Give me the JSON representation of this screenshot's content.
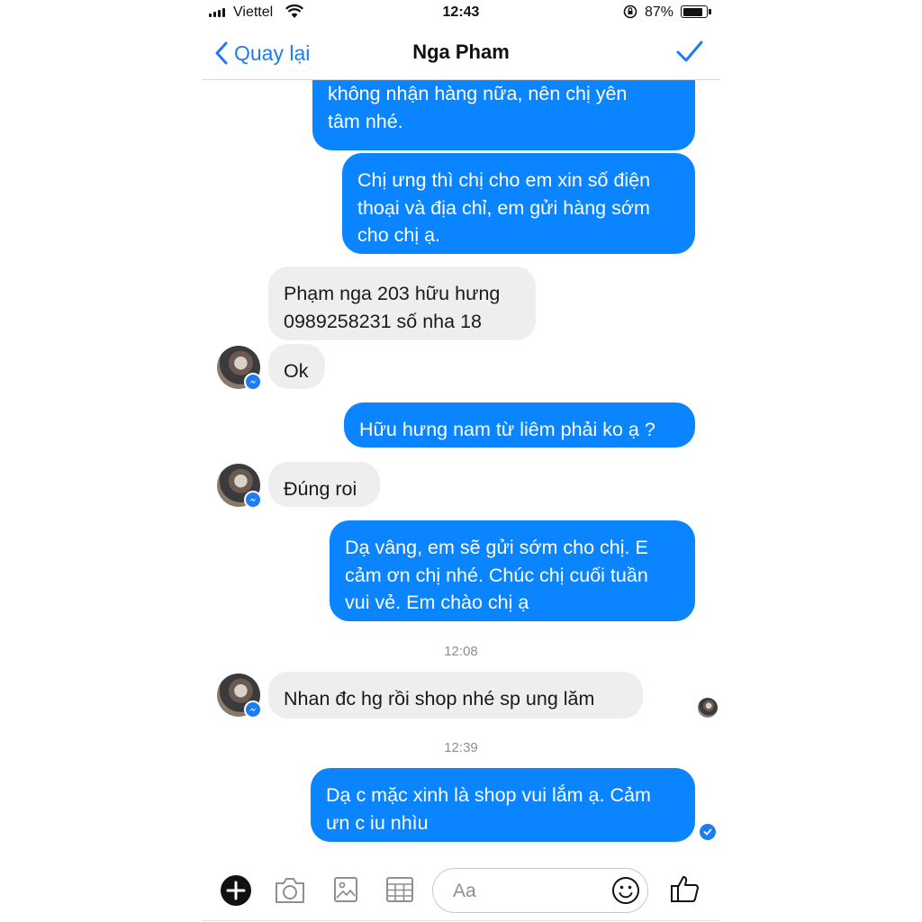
{
  "status_bar": {
    "carrier": "Viettel",
    "time": "12:43",
    "battery": "87%",
    "battery_level": 0.87
  },
  "header": {
    "back_label": "Quay lại",
    "title": "Nga Pham"
  },
  "messages": [
    {
      "dir": "out",
      "text": "không nhận hàng nữa, nên chị yên\ntâm nhé."
    },
    {
      "dir": "out",
      "text": "Chị ưng thì chị cho em xin số điện\nthoại và địa chỉ, em gửi hàng sớm\ncho chị ạ."
    },
    {
      "dir": "in",
      "text": "Phạm nga 203 hữu hưng\n0989258231 số nha 18"
    },
    {
      "dir": "in",
      "text": "Ok"
    },
    {
      "dir": "out",
      "text": "Hữu hưng nam từ liêm phải ko ạ ?"
    },
    {
      "dir": "in",
      "text": "Đúng roi"
    },
    {
      "dir": "out",
      "text": "Dạ vâng, em sẽ gửi sớm cho chị. E\ncảm ơn chị nhé. Chúc chị cuối tuần\nvui vẻ. Em chào chị ạ"
    },
    {
      "dir": "in",
      "text": "Nhan đc hg rồi shop nhé sp ung lăm"
    },
    {
      "dir": "out",
      "text": "Dạ c mặc xinh là shop vui lắm ạ. Cảm\nưn c iu nhìu"
    }
  ],
  "timestamps": [
    "12:08",
    "12:39"
  ],
  "composer": {
    "placeholder": "Aa"
  },
  "icons": [
    "chevron-left-icon",
    "checkmark-icon",
    "plus-icon",
    "camera-icon",
    "image-icon",
    "sticker-grid-icon",
    "smile-icon",
    "thumbs-up-icon",
    "messenger-badge-icon"
  ],
  "colors": {
    "accent": "#1d7cf2",
    "outgoing_bubble": "#0a84ff",
    "incoming_bubble": "#eeeeee",
    "timestamp": "#8e8e93"
  }
}
